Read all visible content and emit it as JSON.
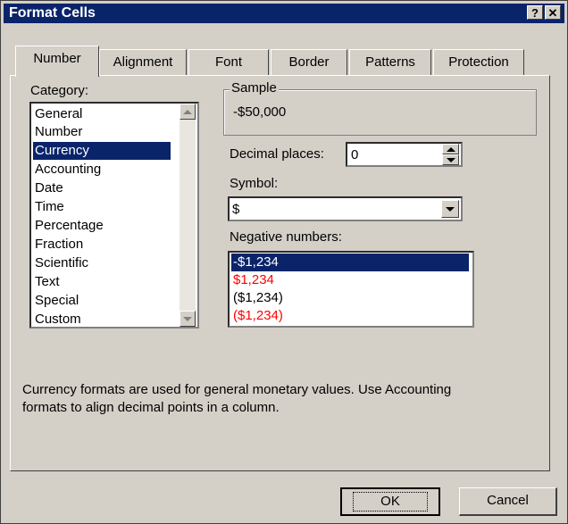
{
  "window": {
    "title": "Format Cells",
    "help_label": "?",
    "close_label": "✕"
  },
  "tabs": [
    {
      "label": "Number"
    },
    {
      "label": "Alignment"
    },
    {
      "label": "Font"
    },
    {
      "label": "Border"
    },
    {
      "label": "Patterns"
    },
    {
      "label": "Protection"
    }
  ],
  "category": {
    "label": "Category:",
    "items": [
      "General",
      "Number",
      "Currency",
      "Accounting",
      "Date",
      "Time",
      "Percentage",
      "Fraction",
      "Scientific",
      "Text",
      "Special",
      "Custom"
    ],
    "selected": "Currency"
  },
  "sample": {
    "label": "Sample",
    "value": "-$50,000"
  },
  "decimal_places": {
    "label": "Decimal places:",
    "value": "0"
  },
  "symbol": {
    "label": "Symbol:",
    "value": "$"
  },
  "negative_numbers": {
    "label": "Negative numbers:",
    "items": [
      {
        "text": "-$1,234",
        "color": "#000000"
      },
      {
        "text": "$1,234",
        "color": "#ff0000"
      },
      {
        "text": "($1,234)",
        "color": "#000000"
      },
      {
        "text": "($1,234)",
        "color": "#ff0000"
      }
    ],
    "selected_index": 0
  },
  "description": {
    "line1": "Currency formats are used for general monetary values.  Use Accounting",
    "line2": "formats to align decimal points in a column."
  },
  "buttons": {
    "ok": "OK",
    "cancel": "Cancel"
  }
}
